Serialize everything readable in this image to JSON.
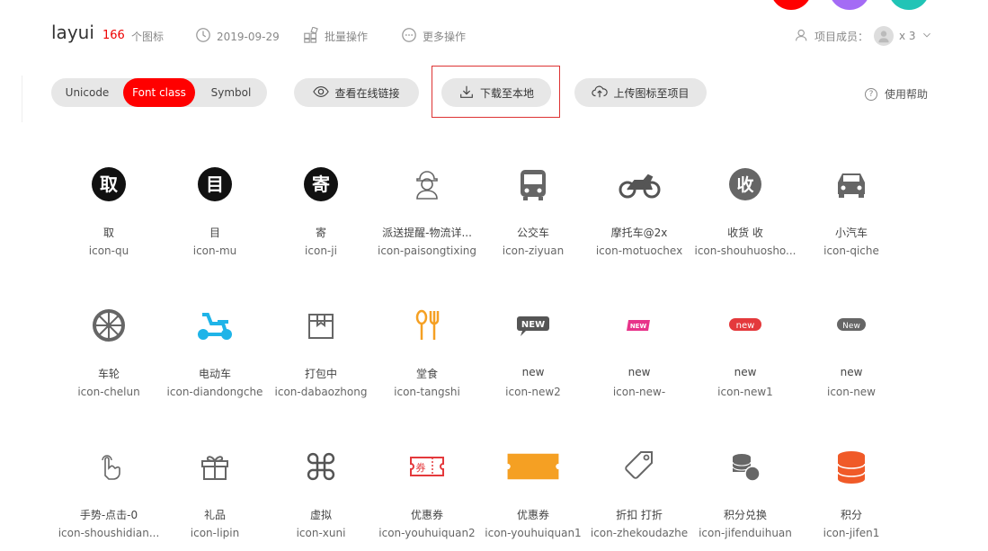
{
  "header": {
    "project_name": "layui",
    "icon_count": "166",
    "icon_count_unit": "个图标",
    "date": "2019-09-29",
    "batch_label": "批量操作",
    "more_label": "更多操作",
    "members_label": "项目成员：",
    "members_count": "x 3"
  },
  "toolbar": {
    "unicode_label": "Unicode",
    "fontclass_label": "Font class",
    "symbol_label": "Symbol",
    "view_link_label": "查看在线链接",
    "download_label": "下载至本地",
    "upload_label": "上传图标至项目",
    "help_label": "使用帮助"
  },
  "colors": {
    "accent": "#ff0000",
    "icon_dark": "#333333",
    "icon_grey": "#666666",
    "icon_blue": "#1fb4e8",
    "icon_orange": "#f5a023",
    "icon_red": "#e4393c",
    "icon_pink": "#e8338a"
  },
  "icons": [
    {
      "name": "取",
      "code": "icon-qu",
      "glyph": "qu-icon"
    },
    {
      "name": "目",
      "code": "icon-mu",
      "glyph": "mu-icon"
    },
    {
      "name": "寄",
      "code": "icon-ji",
      "glyph": "ji-icon"
    },
    {
      "name": "派送提醒-物流详...",
      "code": "icon-paisongtixing",
      "glyph": "courier-icon"
    },
    {
      "name": "公交车",
      "code": "icon-ziyuan",
      "glyph": "bus-icon"
    },
    {
      "name": "摩托车@2x",
      "code": "icon-motuochex",
      "glyph": "motorcycle-icon"
    },
    {
      "name": "收货 收",
      "code": "icon-shouhuosho...",
      "glyph": "shou-icon"
    },
    {
      "name": "小汽车",
      "code": "icon-qiche",
      "glyph": "car-icon"
    },
    {
      "name": "车轮",
      "code": "icon-chelun",
      "glyph": "wheel-icon"
    },
    {
      "name": "电动车",
      "code": "icon-diandongche",
      "glyph": "scooter-icon"
    },
    {
      "name": "打包中",
      "code": "icon-dabaozhong",
      "glyph": "package-icon"
    },
    {
      "name": "堂食",
      "code": "icon-tangshi",
      "glyph": "dining-icon"
    },
    {
      "name": "new",
      "code": "icon-new2",
      "glyph": "new-bubble-icon"
    },
    {
      "name": "new",
      "code": "icon-new-",
      "glyph": "new-pink-icon"
    },
    {
      "name": "new",
      "code": "icon-new1",
      "glyph": "new-red-icon"
    },
    {
      "name": "new",
      "code": "icon-new",
      "glyph": "new-grey-icon"
    },
    {
      "name": "手势-点击-0",
      "code": "icon-shoushidian...",
      "glyph": "tap-gesture-icon"
    },
    {
      "name": "礼品",
      "code": "icon-lipin",
      "glyph": "gift-icon"
    },
    {
      "name": "虚拟",
      "code": "icon-xuni",
      "glyph": "virtual-icon"
    },
    {
      "name": "优惠券",
      "code": "icon-youhuiquan2",
      "glyph": "coupon-outline-icon"
    },
    {
      "name": "优惠券",
      "code": "icon-youhuiquan1",
      "glyph": "coupon-filled-icon"
    },
    {
      "name": "折扣 打折",
      "code": "icon-zhekoudazhe",
      "glyph": "discount-tag-icon"
    },
    {
      "name": "积分兑换",
      "code": "icon-jifenduihuan",
      "glyph": "points-exchange-icon"
    },
    {
      "name": "积分",
      "code": "icon-jifen1",
      "glyph": "points-icon"
    }
  ]
}
